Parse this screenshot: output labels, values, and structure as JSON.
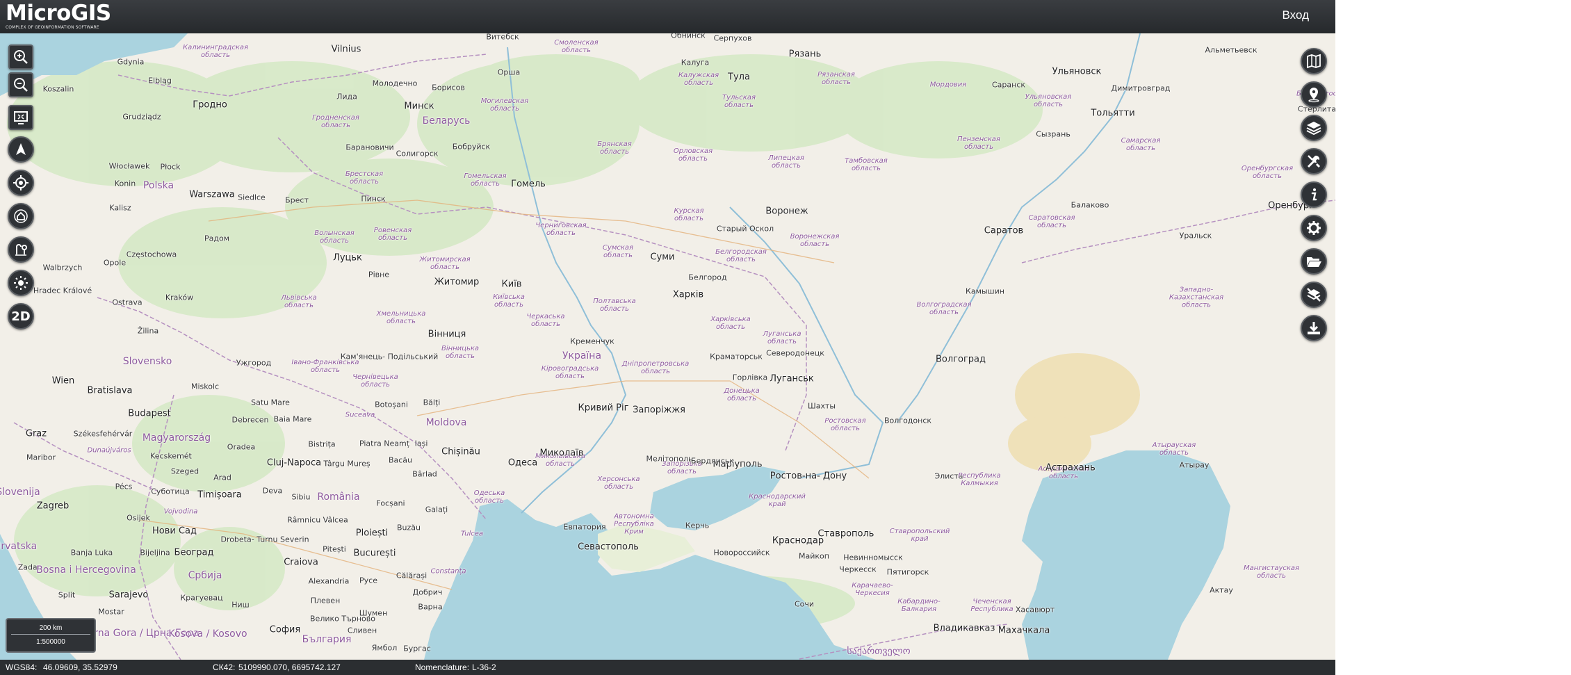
{
  "header": {
    "logo_text": "MicroGIS",
    "logo_tagline": "COMPLEX OF GEOINFORMATION SOFTWARE",
    "login_label": "Вход"
  },
  "left_tools": [
    {
      "name": "zoom-in-button",
      "icon": "zoom-in-icon"
    },
    {
      "name": "zoom-out-button",
      "icon": "zoom-out-icon"
    },
    {
      "name": "full-extent-button",
      "icon": "extent-icon"
    },
    {
      "name": "north-arrow-button",
      "icon": "north-arrow-icon"
    },
    {
      "name": "my-location-button",
      "icon": "crosshair-icon"
    },
    {
      "name": "home-button",
      "icon": "home-icon"
    },
    {
      "name": "route-button",
      "icon": "route-icon"
    },
    {
      "name": "lighting-button",
      "icon": "sun-icon"
    },
    {
      "name": "view-2d-button",
      "icon": "view-2d-icon",
      "label": "2D"
    }
  ],
  "right_tools": [
    {
      "name": "map-button",
      "icon": "map-icon"
    },
    {
      "name": "location-pin-button",
      "icon": "location-pin-icon"
    },
    {
      "name": "layers-button",
      "icon": "layers-icon"
    },
    {
      "name": "tools-button",
      "icon": "tools-icon"
    },
    {
      "name": "info-button",
      "icon": "info-icon"
    },
    {
      "name": "settings-button",
      "icon": "gear-icon"
    },
    {
      "name": "open-folder-button",
      "icon": "folder-icon"
    },
    {
      "name": "clear-layers-button",
      "icon": "layers-off-icon"
    },
    {
      "name": "download-button",
      "icon": "download-icon"
    }
  ],
  "scale": {
    "bar_label": "200 km",
    "ratio": "1:500000"
  },
  "expand_label": "»",
  "status": {
    "wgs84_label": "WGS84:",
    "wgs84_value": "46.09609, 35.52979",
    "sk42_label": "СК42:",
    "sk42_value": "5109990.070, 6695742.127",
    "nomenclature_label": "Nomenclature:",
    "nomenclature_value": "L-36-2"
  },
  "colors": {
    "sea": "#aad3df",
    "land": "#f2efe8",
    "forest": "#cfe6bf",
    "border": "#b590c0",
    "river": "#8fbfd8",
    "desert": "#efe1b9",
    "toolbar": "#2f3236"
  },
  "places": [
    {
      "t": "Gdynia",
      "c": "place"
    },
    {
      "t": "Vilnius",
      "c": "place major"
    },
    {
      "t": "Витебск",
      "c": "place"
    },
    {
      "t": "Смоленская\nобласть",
      "c": "place region"
    },
    {
      "t": "Обнинск",
      "c": "place"
    },
    {
      "t": "Серпухов",
      "c": "place"
    },
    {
      "t": "Рязань",
      "c": "place major"
    },
    {
      "t": "Альметьевск",
      "c": "place"
    },
    {
      "t": "Калининградская\nобласть",
      "c": "place region"
    },
    {
      "t": "Koszalin",
      "c": "place"
    },
    {
      "t": "Elbląg",
      "c": "place"
    },
    {
      "t": "Молодечно",
      "c": "place"
    },
    {
      "t": "Борисов",
      "c": "place"
    },
    {
      "t": "Орша",
      "c": "place"
    },
    {
      "t": "Калуга",
      "c": "place"
    },
    {
      "t": "Тула",
      "c": "place major"
    },
    {
      "t": "Ульяновск",
      "c": "place major"
    },
    {
      "t": "Димитровград",
      "c": "place"
    },
    {
      "t": "Гродно",
      "c": "place major"
    },
    {
      "t": "Лида",
      "c": "place"
    },
    {
      "t": "Минск",
      "c": "place major"
    },
    {
      "t": "Калужская\nобласть",
      "c": "place region"
    },
    {
      "t": "Рязанская\nобласть",
      "c": "place region"
    },
    {
      "t": "Мордовия",
      "c": "place region"
    },
    {
      "t": "Саранск",
      "c": "place"
    },
    {
      "t": "Ульяновская\nобласть",
      "c": "place region"
    },
    {
      "t": "Тольятти",
      "c": "place major"
    },
    {
      "t": "Grudziądz",
      "c": "place"
    },
    {
      "t": "Беларусь",
      "c": "place country"
    },
    {
      "t": "Могилевская\nобласть",
      "c": "place region"
    },
    {
      "t": "Тульская\nобласть",
      "c": "place region"
    },
    {
      "t": "Гродненская\nобласть",
      "c": "place region"
    },
    {
      "t": "Барановичи",
      "c": "place"
    },
    {
      "t": "Бобруйск",
      "c": "place"
    },
    {
      "t": "Сызрань",
      "c": "place"
    },
    {
      "t": "Пензенская\nобласть",
      "c": "place region"
    },
    {
      "t": "Самарская\nобласть",
      "c": "place region"
    },
    {
      "t": "Брянская\nобласть",
      "c": "place region"
    },
    {
      "t": "Орловская\nобласть",
      "c": "place region"
    },
    {
      "t": "Солигорск",
      "c": "place"
    },
    {
      "t": "Липецкая\nобласть",
      "c": "place region"
    },
    {
      "t": "Тамбовская\nобласть",
      "c": "place region"
    },
    {
      "t": "Włocławek",
      "c": "place"
    },
    {
      "t": "Płock",
      "c": "place"
    },
    {
      "t": "Брестская\nобласть",
      "c": "place region"
    },
    {
      "t": "Гомельская\nобласть",
      "c": "place region"
    },
    {
      "t": "Гомель",
      "c": "place major"
    },
    {
      "t": "Оренбургская\nобласть",
      "c": "place region"
    },
    {
      "t": "Konin",
      "c": "place"
    },
    {
      "t": "Polska",
      "c": "place country"
    },
    {
      "t": "Warszawa",
      "c": "place major"
    },
    {
      "t": "Siedlce",
      "c": "place"
    },
    {
      "t": "Брест",
      "c": "place"
    },
    {
      "t": "Пинск",
      "c": "place"
    },
    {
      "t": "Балаково",
      "c": "place"
    },
    {
      "t": "Оренбург",
      "c": "place major"
    },
    {
      "t": "Воронеж",
      "c": "place major"
    },
    {
      "t": "Курская\nобласть",
      "c": "place region"
    },
    {
      "t": "Kalisz",
      "c": "place"
    },
    {
      "t": "Старый\nОскол",
      "c": "place"
    },
    {
      "t": "Саратовская\nобласть",
      "c": "place region"
    },
    {
      "t": "Саратов",
      "c": "place major"
    },
    {
      "t": "Черниговская\nобласть",
      "c": "place region"
    },
    {
      "t": "Радом",
      "c": "place"
    },
    {
      "t": "Волынская\nобласть",
      "c": "place region"
    },
    {
      "t": "Ровенская\nобласть",
      "c": "place region"
    },
    {
      "t": "Воронежская\nобласть",
      "c": "place region"
    },
    {
      "t": "Уральск",
      "c": "place"
    },
    {
      "t": "Сумская\nобласть",
      "c": "place region"
    },
    {
      "t": "Белгородская\nобласть",
      "c": "place region"
    },
    {
      "t": "Częstochowa",
      "c": "place"
    },
    {
      "t": "Луцьк",
      "c": "place major"
    },
    {
      "t": "Суми",
      "c": "place major"
    },
    {
      "t": "Житомирская\nобласть",
      "c": "place region"
    },
    {
      "t": "Opole",
      "c": "place"
    },
    {
      "t": "Рівне",
      "c": "place"
    },
    {
      "t": "Белгород",
      "c": "place"
    },
    {
      "t": "Walbrzych",
      "c": "place"
    },
    {
      "t": "Житомир",
      "c": "place major"
    },
    {
      "t": "Київ",
      "c": "place major"
    },
    {
      "t": "Камышин",
      "c": "place"
    },
    {
      "t": "Западно-\nКазахстанская\nобласть",
      "c": "place region"
    },
    {
      "t": "Hradec\nKrálové",
      "c": "place"
    },
    {
      "t": "Харків",
      "c": "place major"
    },
    {
      "t": "Ostrava",
      "c": "place"
    },
    {
      "t": "Львівська\nобласть",
      "c": "place region"
    },
    {
      "t": "Київська\nобласть",
      "c": "place region"
    },
    {
      "t": "Полтавська\nобласть",
      "c": "place region"
    },
    {
      "t": "Волгоградская\nобласть",
      "c": "place region"
    },
    {
      "t": "Хмельницька\nобласть",
      "c": "place region"
    },
    {
      "t": "Черкаська\nобласть",
      "c": "place region"
    },
    {
      "t": "Харківська\nобласть",
      "c": "place region"
    },
    {
      "t": "Žilina",
      "c": "place"
    },
    {
      "t": "Вінниця",
      "c": "place major"
    },
    {
      "t": "Кременчук",
      "c": "place"
    },
    {
      "t": "Луганська\nобласть",
      "c": "place region"
    },
    {
      "t": "Кам'янець-\nПодільський",
      "c": "place"
    },
    {
      "t": "Вінницька\nобласть",
      "c": "place region"
    },
    {
      "t": "Україна",
      "c": "place country"
    },
    {
      "t": "Краматорськ",
      "c": "place"
    },
    {
      "t": "Северодонецк",
      "c": "place"
    },
    {
      "t": "Slovensko",
      "c": "place country"
    },
    {
      "t": "Ужгород",
      "c": "place"
    },
    {
      "t": "Івано-Франківська\nобласть",
      "c": "place region"
    },
    {
      "t": "Дніпропетровська\nобласть",
      "c": "place region"
    },
    {
      "t": "Волгоград",
      "c": "place major"
    },
    {
      "t": "Wien",
      "c": "place major"
    },
    {
      "t": "Bratislava",
      "c": "place major"
    },
    {
      "t": "Miskolc",
      "c": "place"
    },
    {
      "t": "Чернівецька\nобласть",
      "c": "place region"
    },
    {
      "t": "Кіровоградська\nобласть",
      "c": "place region"
    },
    {
      "t": "Горлівка",
      "c": "place"
    },
    {
      "t": "Луганськ",
      "c": "place major"
    },
    {
      "t": "Донецька\nобласть",
      "c": "place region"
    },
    {
      "t": "Satu Mare",
      "c": "place"
    },
    {
      "t": "Botoșani",
      "c": "place"
    },
    {
      "t": "Bălți",
      "c": "place"
    },
    {
      "t": "Кривий Ріг",
      "c": "place major"
    },
    {
      "t": "Запоріжжя",
      "c": "place major"
    },
    {
      "t": "Шахты",
      "c": "place"
    },
    {
      "t": "Budapest",
      "c": "place major"
    },
    {
      "t": "Debrecen",
      "c": "place"
    },
    {
      "t": "Baia Mare",
      "c": "place"
    },
    {
      "t": "Suceava",
      "c": "place region"
    },
    {
      "t": "Moldova",
      "c": "place country"
    },
    {
      "t": "Ростовская\nобласть",
      "c": "place region"
    },
    {
      "t": "Волгодонск",
      "c": "place"
    },
    {
      "t": "Атырауская\nобласть",
      "c": "place region"
    },
    {
      "t": "Graz",
      "c": "place major"
    },
    {
      "t": "Székesfehérvár",
      "c": "place"
    },
    {
      "t": "Magyarország",
      "c": "place country"
    },
    {
      "t": "Oradea",
      "c": "place"
    },
    {
      "t": "Bistrița",
      "c": "place"
    },
    {
      "t": "Piatra Neamț",
      "c": "place"
    },
    {
      "t": "Iași",
      "c": "place"
    },
    {
      "t": "Chișinău",
      "c": "place major"
    },
    {
      "t": "Миколаївська\nобласть",
      "c": "place region"
    },
    {
      "t": "Запорізька\nобласть",
      "c": "place region"
    },
    {
      "t": "Маріуполь",
      "c": "place major"
    },
    {
      "t": "Ростов-на-\nДону",
      "c": "place major"
    },
    {
      "t": "Астраханская\nобласть",
      "c": "place region"
    },
    {
      "t": "Атырау",
      "c": "place"
    },
    {
      "t": "Maribor",
      "c": "place"
    },
    {
      "t": "Dunaújváros",
      "c": "place region"
    },
    {
      "t": "Kecskemét",
      "c": "place"
    },
    {
      "t": "Cluj-Napoca",
      "c": "place major"
    },
    {
      "t": "Târgu Mureș",
      "c": "place"
    },
    {
      "t": "Bacău",
      "c": "place"
    },
    {
      "t": "Одеса",
      "c": "place major"
    },
    {
      "t": "Миколаїв",
      "c": "place major"
    },
    {
      "t": "Херсонська\nобласть",
      "c": "place region"
    },
    {
      "t": "Мелітополь",
      "c": "place"
    },
    {
      "t": "Бердянськ",
      "c": "place"
    },
    {
      "t": "Астрахань",
      "c": "place major"
    },
    {
      "t": "Szeged",
      "c": "place"
    },
    {
      "t": "Arad",
      "c": "place"
    },
    {
      "t": "Bârlad",
      "c": "place"
    },
    {
      "t": "Элиста",
      "c": "place"
    },
    {
      "t": "Республика\nКалмыкия",
      "c": "place region"
    },
    {
      "t": "Slovenija",
      "c": "place country"
    },
    {
      "t": "Pécs",
      "c": "place"
    },
    {
      "t": "Суботица",
      "c": "place"
    },
    {
      "t": "Timișoara",
      "c": "place major"
    },
    {
      "t": "Deva",
      "c": "place"
    },
    {
      "t": "Sibiu",
      "c": "place"
    },
    {
      "t": "România",
      "c": "place country"
    },
    {
      "t": "Focșani",
      "c": "place"
    },
    {
      "t": "Galați",
      "c": "place"
    },
    {
      "t": "Одеська\nобласть",
      "c": "place region"
    },
    {
      "t": "Краснодарский\nкрай",
      "c": "place region"
    },
    {
      "t": "Zagreb",
      "c": "place major"
    },
    {
      "t": "Osijek",
      "c": "place"
    },
    {
      "t": "Vojvodina",
      "c": "place region"
    },
    {
      "t": "Râmnicu\nVâlcea",
      "c": "place"
    },
    {
      "t": "Tulcea",
      "c": "place region"
    },
    {
      "t": "Автономна\nРеспубліка\nКрим",
      "c": "place region"
    },
    {
      "t": "Евпатория",
      "c": "place"
    },
    {
      "t": "Керчь",
      "c": "place"
    },
    {
      "t": "Нови Сад",
      "c": "place major"
    },
    {
      "t": "Drobeta-\nTurnu\nSeverin",
      "c": "place"
    },
    {
      "t": "Ploiești",
      "c": "place major"
    },
    {
      "t": "Buzău",
      "c": "place"
    },
    {
      "t": "Ставрополь",
      "c": "place major"
    },
    {
      "t": "Ставропольский\nкрай",
      "c": "place region"
    },
    {
      "t": "Hrvatska",
      "c": "place country"
    },
    {
      "t": "Banja Luka",
      "c": "place"
    },
    {
      "t": "Bijeljina",
      "c": "place"
    },
    {
      "t": "Београд",
      "c": "place major"
    },
    {
      "t": "Pitești",
      "c": "place"
    },
    {
      "t": "București",
      "c": "place major"
    },
    {
      "t": "Севастополь",
      "c": "place major"
    },
    {
      "t": "Новороссийск",
      "c": "place"
    },
    {
      "t": "Краснодар",
      "c": "place major"
    },
    {
      "t": "Невинномысск",
      "c": "place"
    },
    {
      "t": "Craiova",
      "c": "place major"
    },
    {
      "t": "Călărași",
      "c": "place"
    },
    {
      "t": "Constanța",
      "c": "place region"
    },
    {
      "t": "Майкоп",
      "c": "place"
    },
    {
      "t": "Черкесск",
      "c": "place"
    },
    {
      "t": "Пятигорск",
      "c": "place"
    },
    {
      "t": "Zadar",
      "c": "place"
    },
    {
      "t": "Bosna i Hercegovina",
      "c": "place country"
    },
    {
      "t": "Србија",
      "c": "place country"
    },
    {
      "t": "Alexandria",
      "c": "place"
    },
    {
      "t": "Русе",
      "c": "place"
    },
    {
      "t": "Мангистауская\nобласть",
      "c": "place region"
    },
    {
      "t": "Split",
      "c": "place"
    },
    {
      "t": "Sarajevo",
      "c": "place major"
    },
    {
      "t": "Крагуевац",
      "c": "place"
    },
    {
      "t": "Добрич",
      "c": "place"
    },
    {
      "t": "Карачаево-\nЧеркесия",
      "c": "place region"
    },
    {
      "t": "Кабардино-\nБалкария",
      "c": "place region"
    },
    {
      "t": "Актау",
      "c": "place"
    },
    {
      "t": "Ниш",
      "c": "place"
    },
    {
      "t": "Плевен",
      "c": "place"
    },
    {
      "t": "Варна",
      "c": "place"
    },
    {
      "t": "Сочи",
      "c": "place"
    },
    {
      "t": "Чеченская\nРеспублика",
      "c": "place region"
    },
    {
      "t": "Хасавюрт",
      "c": "place"
    },
    {
      "t": "Mostar",
      "c": "place"
    },
    {
      "t": "Велико\nТърново",
      "c": "place"
    },
    {
      "t": "Шумен",
      "c": "place"
    },
    {
      "t": "Crna Gora /\nЦрна Гора",
      "c": "place country"
    },
    {
      "t": "Kosova /\nKosovo",
      "c": "place country"
    },
    {
      "t": "София",
      "c": "place major"
    },
    {
      "t": "България",
      "c": "place country"
    },
    {
      "t": "Сливен",
      "c": "place"
    },
    {
      "t": "Бургас",
      "c": "place"
    },
    {
      "t": "Ямбол",
      "c": "place"
    },
    {
      "t": "Владикавказ",
      "c": "place major"
    },
    {
      "t": "Махачкала",
      "c": "place major"
    },
    {
      "t": "საქართველო",
      "c": "place country"
    },
    {
      "t": "Стерлитама",
      "c": "place"
    },
    {
      "t": "Башкортоста",
      "c": "place region"
    },
    {
      "t": "Kraków",
      "c": "place"
    }
  ]
}
